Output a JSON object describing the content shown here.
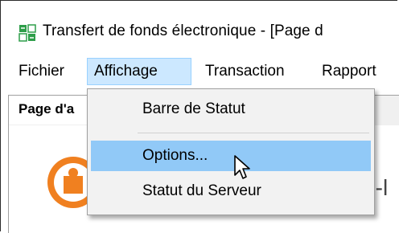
{
  "window": {
    "title": "Transfert de fonds électronique - [Page d",
    "icon": "app-transfer-icon"
  },
  "menubar": {
    "items": [
      {
        "label": "Fichier"
      },
      {
        "label": "Affichage",
        "active": true
      },
      {
        "label": "Transaction"
      },
      {
        "label": "Rapport"
      }
    ]
  },
  "tabs": [
    {
      "label": "Page d'a"
    }
  ],
  "content": {
    "partial_text": "X-l",
    "logo_icon": "orange-logo-icon"
  },
  "dropdown": {
    "items": [
      {
        "label": "Barre de Statut"
      },
      {
        "label": "Options...",
        "hover": true
      },
      {
        "label": "Statut du Serveur"
      }
    ]
  },
  "colors": {
    "menu_active_bg": "#cce8ff",
    "dropdown_hover_bg": "#91c9f7",
    "logo_orange": "#f08020"
  }
}
